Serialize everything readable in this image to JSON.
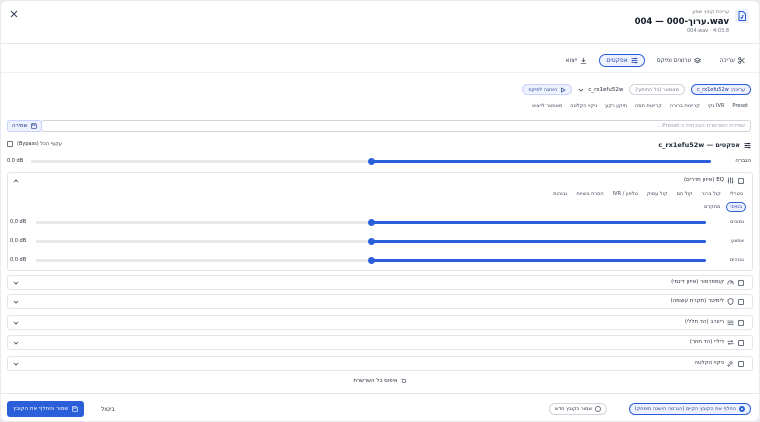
{
  "header": {
    "subtitle": "עריכת קובץ שמע",
    "title": "004 — 000-ערוך.wav",
    "meta": "004.wav · 4:03.8"
  },
  "tabs": [
    {
      "label": "עריכה",
      "icon": "scissors-icon"
    },
    {
      "label": "ערוצים ומיקס",
      "icon": "layers-icon"
    },
    {
      "label": "אפקטים",
      "icon": "sliders-icon",
      "active": true
    },
    {
      "label": "ייצוא",
      "icon": "download-icon"
    }
  ],
  "target": {
    "editing_label": "עריכה: c_rx1efu52w",
    "master_label": "מאסטר (כל החיתוך)",
    "track_select": "c_rx1efu52w",
    "play_button": "האזנה לפיקס"
  },
  "presets": {
    "label": "Preset",
    "items": [
      "IVR נקי",
      "קריינות ברורה",
      "קריינות חמה",
      "תיקון רקע",
      "ניקוי הקלטה",
      "מאסטר לייצוא"
    ],
    "save_label": "שמירה",
    "name_placeholder": "שמירת השרשרת הנוכחית כ-Preset..."
  },
  "effects": {
    "title": "אפקטים — c_rx1efu52w",
    "bypass_label": "עקוף הכל (Bypass)",
    "gain_label": "הגברה",
    "gain_value": "0.0 dB",
    "gain_level": 0.5
  },
  "eq": {
    "label": "EQ (איזון תדרים)",
    "presets_row1": [
      "ניטרלי",
      "קול ברור",
      "קול חם",
      "קול עמוק",
      "טלפון / IVR",
      "הסרת בוציות",
      "גבוהות"
    ],
    "presets_row2": [
      "בסיסי",
      "מתקדם"
    ],
    "bands": [
      {
        "label": "נמוכים",
        "value": "0.0 dB",
        "level": 0.5
      },
      {
        "label": "אמצע",
        "value": "0.0 dB",
        "level": 0.5
      },
      {
        "label": "גבוהים",
        "value": "0.0 dB",
        "level": 0.5
      }
    ]
  },
  "other_effects": [
    {
      "label": "קומפרסור (איזון דינמי)",
      "icon": "gauge-icon"
    },
    {
      "label": "לימיטר (תקרת עוצמה)",
      "icon": "shield-icon"
    },
    {
      "label": "ריוורב (הד חללי)",
      "icon": "waves-icon"
    },
    {
      "label": "דיליי (הד חוזר)",
      "icon": "repeat-icon"
    },
    {
      "label": "ניקוי הקלטה",
      "icon": "sparkles-icon"
    }
  ],
  "reset_chain": "איפוס כל השרשרת",
  "footer": {
    "option_replace": "החלף את הקובץ הקיים (הגרסה הישנה תימחק)",
    "option_new": "שמור כקובץ חדש",
    "cancel": "ביטול",
    "save": "שמור והחלף את הקובץ"
  },
  "colors": {
    "accent": "#2b5fd9"
  }
}
